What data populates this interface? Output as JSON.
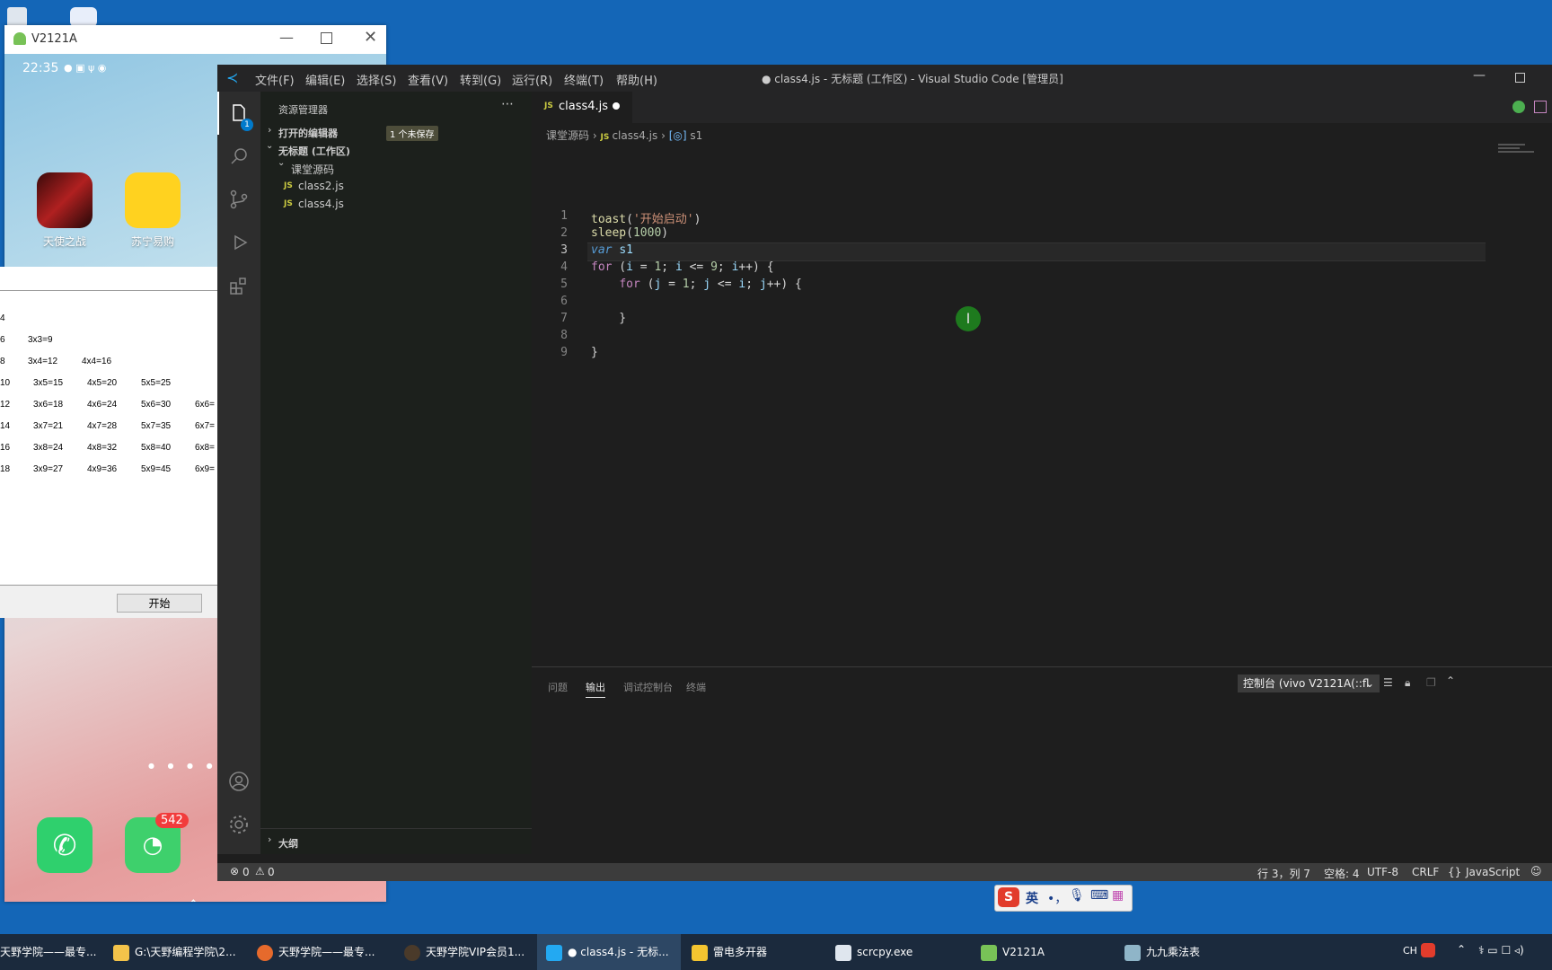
{
  "phone": {
    "window_title": "V2121A",
    "time": "22:35",
    "apps_row1": [
      "天使之战",
      "苏宁易购"
    ],
    "dock_badge": "542"
  },
  "table_dialog": {
    "rows": [
      [
        "4"
      ],
      [
        "6",
        "3x3=9"
      ],
      [
        "8",
        "3x4=12",
        "4x4=16"
      ],
      [
        "10",
        "3x5=15",
        "4x5=20",
        "5x5=25"
      ],
      [
        "12",
        "3x6=18",
        "4x6=24",
        "5x6=30",
        "6x6="
      ],
      [
        "14",
        "3x7=21",
        "4x7=28",
        "5x7=35",
        "6x7="
      ],
      [
        "16",
        "3x8=24",
        "4x8=32",
        "5x8=40",
        "6x8="
      ],
      [
        "18",
        "3x9=27",
        "4x9=36",
        "5x9=45",
        "6x9="
      ]
    ],
    "start_button": "开始"
  },
  "vscode": {
    "menu": [
      "文件(F)",
      "编辑(E)",
      "选择(S)",
      "查看(V)",
      "转到(G)",
      "运行(R)",
      "终端(T)",
      "帮助(H)"
    ],
    "title": "● class4.js - 无标题 (工作区) - Visual Studio Code [管理员]",
    "explorer_badge": "1",
    "sidebar": {
      "header": "资源管理器",
      "open_editors": "打开的编辑器",
      "unsaved_badge": "1 个未保存",
      "workspace": "无标题 (工作区)",
      "folder": "课堂源码",
      "files": [
        "class2.js",
        "class4.js"
      ],
      "outline": "大纲"
    },
    "tab": {
      "name": "class4.js",
      "js_label": "JS"
    },
    "breadcrumb": {
      "folder": "课堂源码",
      "file": "class4.js",
      "symbol": "s1"
    },
    "line_numbers": [
      "1",
      "2",
      "3",
      "4",
      "5",
      "6",
      "7",
      "8",
      "9"
    ],
    "panel": {
      "tabs": [
        "问题",
        "输出",
        "调试控制台",
        "终端"
      ],
      "active_tab": "输出",
      "channel": "控制台 (vivo V2121A(::fl"
    },
    "status": {
      "errors": "0",
      "warnings": "0",
      "position": "行 3，列 7",
      "spaces": "空格: 4",
      "encoding": "UTF-8",
      "eol": "CRLF",
      "language": "JavaScript"
    }
  },
  "ime": {
    "mode": "英",
    "punct": "•，"
  },
  "taskbar": {
    "items": [
      "天野学院——最专...",
      "G:\\天野编程学院\\2...",
      "天野学院——最专...",
      "天野学院VIP会员1...",
      "● class4.js - 无标...",
      "雷电多开器",
      "scrcpy.exe",
      "V2121A",
      "九九乘法表"
    ],
    "tray_lang": "CH"
  },
  "colors": {
    "vscode_blue": "#007acc",
    "desktop": "#1466b7"
  }
}
